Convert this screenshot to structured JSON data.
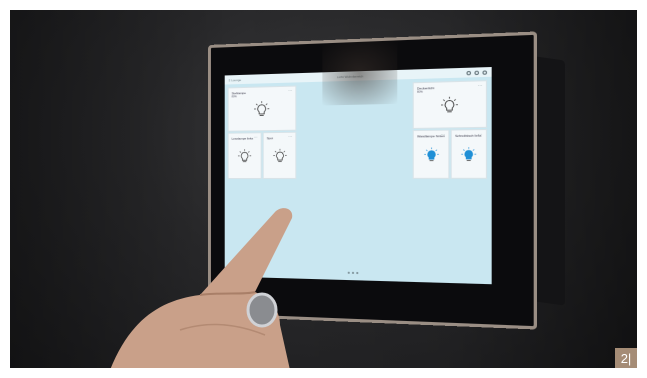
{
  "screen": {
    "header_left": "≡ Lounge",
    "header_center": "Licht Wohnbereich",
    "tiles": [
      {
        "label": "Stehlampe",
        "sub": "80%",
        "state": "off"
      },
      {
        "label": "Leselampe links",
        "sub": "",
        "state": "off"
      },
      {
        "label": "Spot",
        "sub": "",
        "state": "off"
      },
      {
        "label": "Deckenlicht",
        "sub": "80%",
        "state": "off"
      },
      {
        "label": "Wandlampe hinten",
        "sub": "",
        "state": "on"
      },
      {
        "label": "Schreibtisch links",
        "sub": "",
        "state": "on"
      }
    ]
  },
  "badge": "2|",
  "colors": {
    "screen_bg": "#c9e7f1",
    "bulb_on": "#1e8fd6",
    "bezel_frame": "#9a8e84",
    "badge": "#a58c76"
  }
}
